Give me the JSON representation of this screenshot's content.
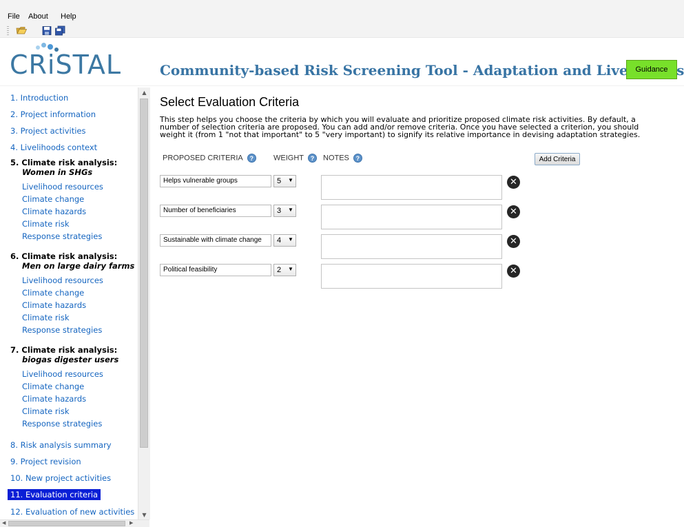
{
  "menu": {
    "file": "File",
    "about": "About",
    "help": "Help"
  },
  "toolbar": {
    "open_icon": "folder-open-icon",
    "save_icon": "save-icon",
    "save_all_icon": "save-all-icon"
  },
  "header": {
    "logo_text": "CRiSTAL",
    "title": "Community-based Risk Screening Tool - Adaptation and Livelihoods",
    "guidance_label": "Guidance"
  },
  "sidebar": {
    "items": {
      "intro": "1. Introduction",
      "project_info": "2. Project information",
      "project_activities": "3. Project activities",
      "livelihoods_context": "4. Livelihoods context",
      "s5_head": "5. Climate risk analysis:",
      "s5_group": "Women in SHGs",
      "s6_head": "6. Climate risk analysis:",
      "s6_group": "Men on large dairy farms",
      "s7_head": "7. Climate risk analysis:",
      "s7_group": "biogas digester users",
      "risk_summary": "8. Risk analysis summary",
      "project_revision": "9. Project revision",
      "new_activities": "10. New project activities",
      "evaluation_criteria": "11. Evaluation criteria",
      "evaluation_new": "12. Evaluation of new activities"
    },
    "sub": {
      "livelihood_resources": "Livelihood resources",
      "climate_change": "Climate change",
      "climate_hazards": "Climate hazards",
      "climate_risk": "Climate risk",
      "response_strategies": "Response strategies"
    }
  },
  "main": {
    "title": "Select Evaluation Criteria",
    "desc_line1": "This step helps you choose the criteria by which you will evaluate and prioritize proposed climate risk activities. By default, a",
    "desc_line2": "number of selection criteria are proposed. You can add and/or remove criteria. Once you have selected a criterion, you should",
    "desc_line3": "weight it (from 1 \"not that important\" to 5 \"very important) to signify its relative importance in devising adaptation strategies.",
    "col_criteria": "PROPOSED CRITERIA",
    "col_weight": "WEIGHT",
    "col_notes": "NOTES",
    "add_label": "Add Criteria",
    "criteria": [
      {
        "name": "Helps vulnerable groups",
        "weight": "5",
        "notes": ""
      },
      {
        "name": "Number of beneficiaries",
        "weight": "3",
        "notes": ""
      },
      {
        "name": "Sustainable with climate change",
        "weight": "4",
        "notes": ""
      },
      {
        "name": "Political feasibility",
        "weight": "2",
        "notes": ""
      }
    ]
  },
  "colors": {
    "accent_blue": "#3874a4",
    "link_blue": "#1565c0",
    "selected_bg": "#0a1fd6",
    "guidance_green": "#78e02a"
  }
}
